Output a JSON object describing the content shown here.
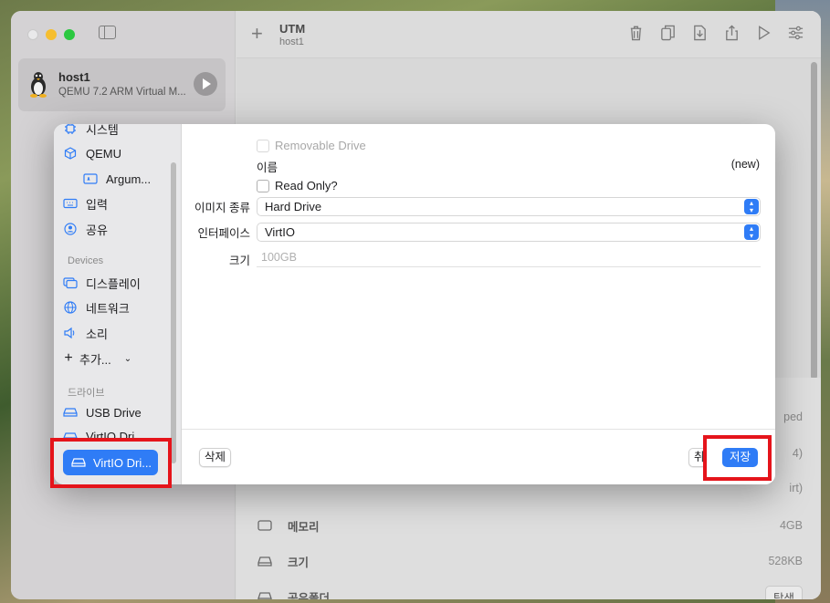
{
  "app": {
    "title": "UTM",
    "subtitle": "host1"
  },
  "sidebar": {
    "vm_name": "host1",
    "vm_desc": "QEMU 7.2 ARM Virtual M..."
  },
  "dialog": {
    "nav": {
      "system": "시스템",
      "qemu": "QEMU",
      "arguments": "Argum...",
      "input": "입력",
      "sharing": "공유",
      "devices_header": "Devices",
      "display": "디스플레이",
      "network": "네트워크",
      "sound": "소리",
      "add": "추가...",
      "drives_header": "드라이브",
      "usb_drive": "USB Drive",
      "virtio_drive_1": "VirtIO Dri...",
      "virtio_drive_selected": "VirtIO Dri..."
    },
    "form": {
      "removable_label": "Removable Drive",
      "name_label": "이름",
      "name_value": "(new)",
      "readonly_label": "Read Only?",
      "image_type_label": "이미지 종류",
      "image_type_value": "Hard Drive",
      "interface_label": "인터페이스",
      "interface_value": "VirtIO",
      "size_label": "크기",
      "size_placeholder": "100GB"
    },
    "footer": {
      "delete_label": "삭제",
      "cancel_label": "취소",
      "save_label": "저장"
    }
  },
  "info": {
    "partial_1": "ped",
    "partial_2": "4)",
    "partial_3": "irt)",
    "memory_label": "메모리",
    "memory_value": "4GB",
    "size_label": "크기",
    "size_value": "528KB",
    "shared_label": "공유폴더",
    "browse_label": "탐색"
  },
  "colors": {
    "accent": "#2f7cf6",
    "highlight": "#e5141b"
  }
}
